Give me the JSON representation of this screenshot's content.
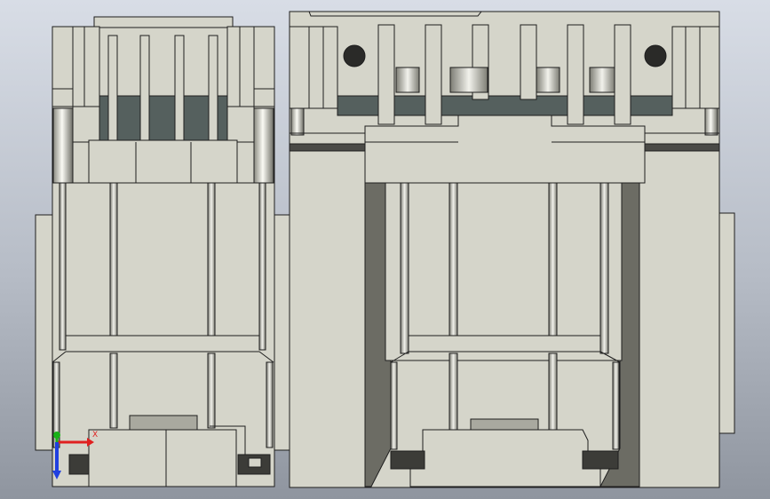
{
  "viewport": {
    "background_top": "#d8dde6",
    "background_bottom": "#8f959f",
    "part_color": "#d5d5ca",
    "edge_color": "#1e1e1e",
    "shadow_color": "#3c3c38"
  },
  "triad": {
    "x_axis_label": "X",
    "y_axis_label": "",
    "x_axis_color": "#e02020",
    "y_axis_color": "#18b018",
    "z_axis_color": "#2040e0"
  }
}
